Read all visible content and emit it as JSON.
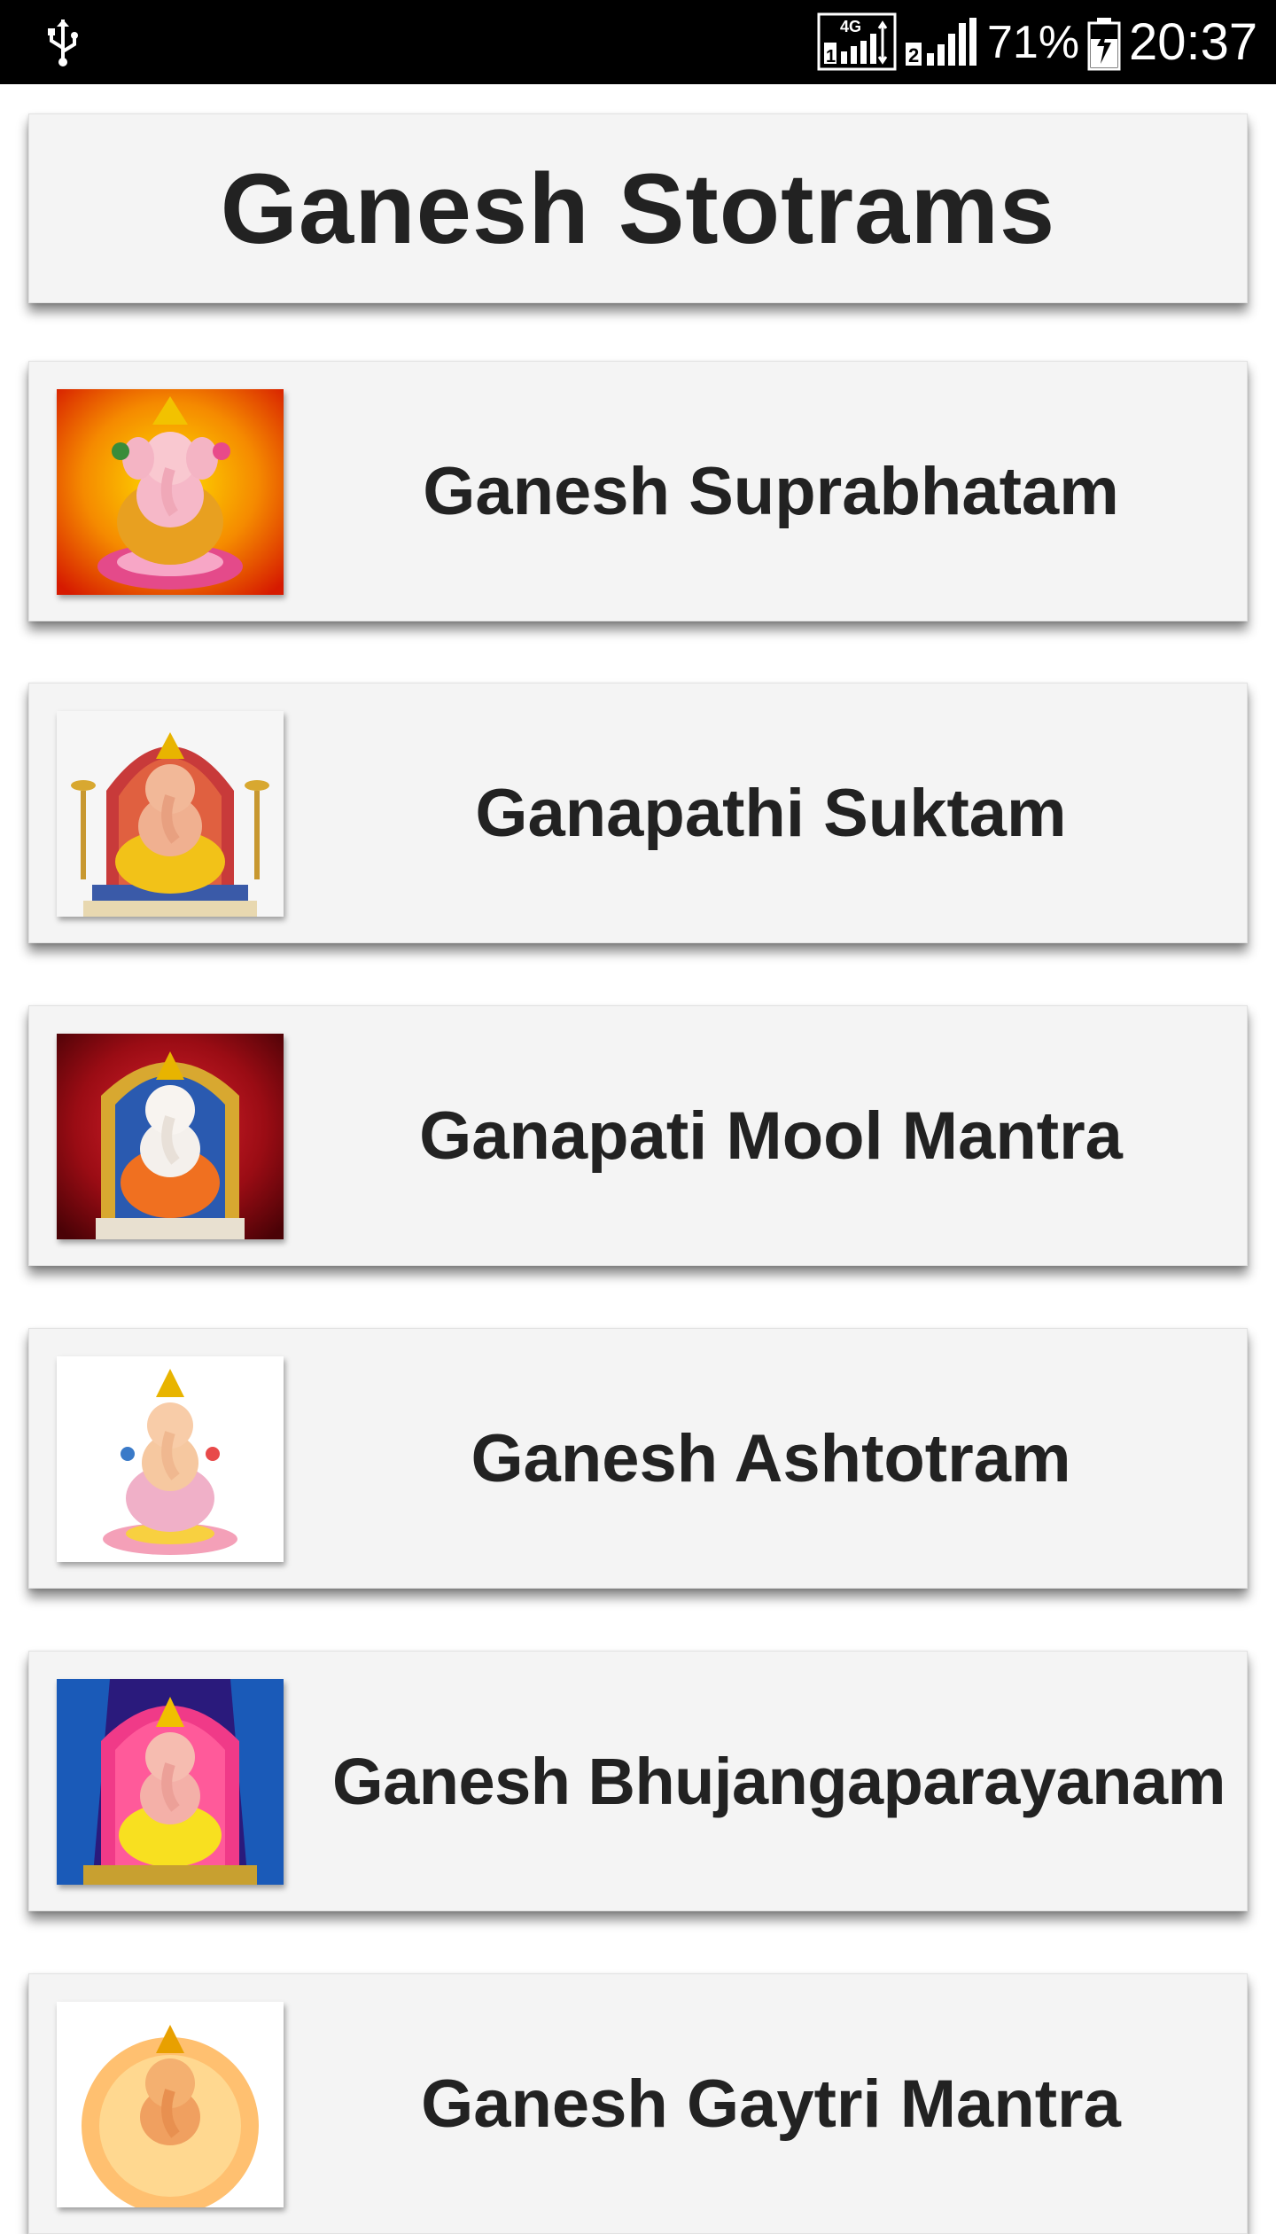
{
  "status_bar": {
    "sim1_network": "4G",
    "sim1_slot": "1",
    "sim2_slot": "2",
    "battery_percent": "71%",
    "time": "20:37",
    "icons": [
      "usb-icon",
      "signal-4g-icon",
      "signal-sim2-icon",
      "battery-charging-icon"
    ]
  },
  "header": {
    "title": "Ganesh Stotrams"
  },
  "items": [
    {
      "label": "Ganesh Suprabhatam",
      "thumb_bg": [
        "#ffd000",
        "#f07000",
        "#d81c00"
      ]
    },
    {
      "label": "Ganapathi Suktam",
      "thumb_bg": [
        "#ffffff",
        "#f2f2f2",
        "#e6e6e6"
      ]
    },
    {
      "label": "Ganapati Mool Mantra",
      "thumb_bg": [
        "#d0202c",
        "#9a0c14",
        "#5c0408"
      ]
    },
    {
      "label": "Ganesh Ashtotram",
      "thumb_bg": [
        "#ffffff",
        "#ffffff",
        "#ffffff"
      ]
    },
    {
      "label": "Ganesh Bhujangaparayanam",
      "thumb_bg": [
        "#ff3a88",
        "#c8186a",
        "#3a1a8c"
      ]
    },
    {
      "label": "Ganesh Gaytri Mantra",
      "thumb_bg": [
        "#ffe8b8",
        "#ffc070",
        "#ffffff"
      ]
    }
  ],
  "colors": {
    "status_bar": "#000000",
    "card": "#f4f4f4",
    "text": "#222222"
  }
}
